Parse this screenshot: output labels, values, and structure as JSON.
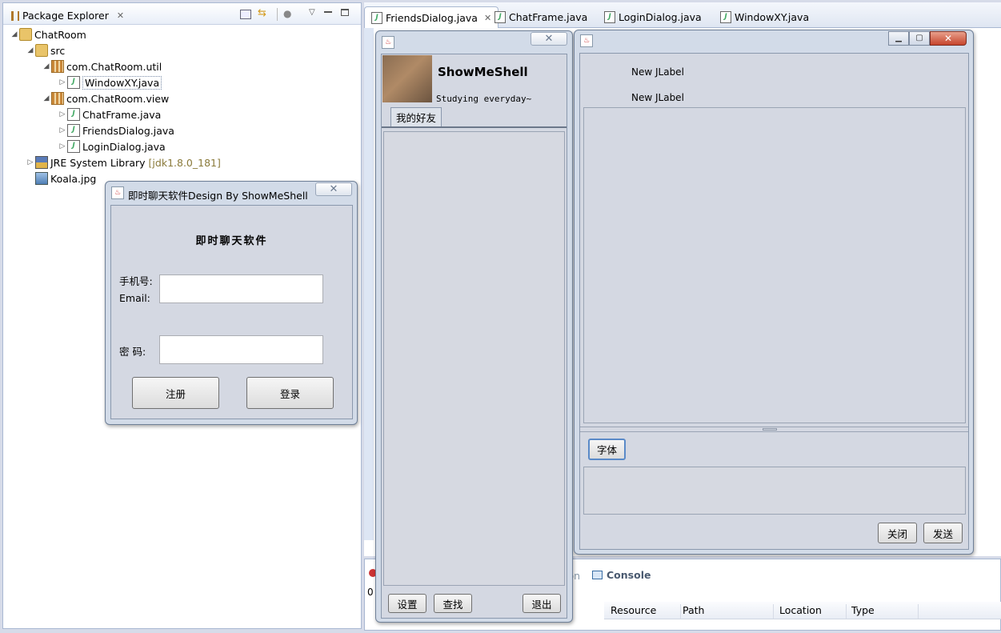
{
  "package_explorer": {
    "title": "Package Explorer",
    "tree": [
      {
        "label": "ChatRoom"
      },
      {
        "label": "src"
      },
      {
        "label": "com.ChatRoom.util"
      },
      {
        "label": "WindowXY.java"
      },
      {
        "label": "com.ChatRoom.view"
      },
      {
        "label": "ChatFrame.java"
      },
      {
        "label": "FriendsDialog.java"
      },
      {
        "label": "LoginDialog.java"
      },
      {
        "label": "JRE System Library",
        "version": "[jdk1.8.0_181]"
      },
      {
        "label": "Koala.jpg"
      }
    ]
  },
  "editor_tabs": [
    {
      "label": "FriendsDialog.java"
    },
    {
      "label": "ChatFrame.java"
    },
    {
      "label": "LoginDialog.java"
    },
    {
      "label": "WindowXY.java"
    }
  ],
  "login_dialog": {
    "title": "即时聊天软件Design By ShowMeShell",
    "heading": "即时聊天软件",
    "phone_label": "手机号:",
    "email_label": "Email:",
    "phone_value": "",
    "password_label": "密 码:",
    "password_value": "",
    "register_button": "注册",
    "login_button": "登录"
  },
  "friends_dialog": {
    "username": "ShowMeShell",
    "signature": "Studying everyday~",
    "tab_label": "我的好友",
    "settings_button": "设置",
    "search_button": "查找",
    "exit_button": "退出"
  },
  "chat_frame": {
    "label1": "New JLabel",
    "label2": "New JLabel",
    "font_button": "字体",
    "close_button": "关闭",
    "send_button": "发送"
  },
  "bottom_panel": {
    "console_label": "Console",
    "partial_tab": "ion",
    "count": "0",
    "columns": [
      "Resource",
      "Path",
      "Location",
      "Type"
    ]
  }
}
